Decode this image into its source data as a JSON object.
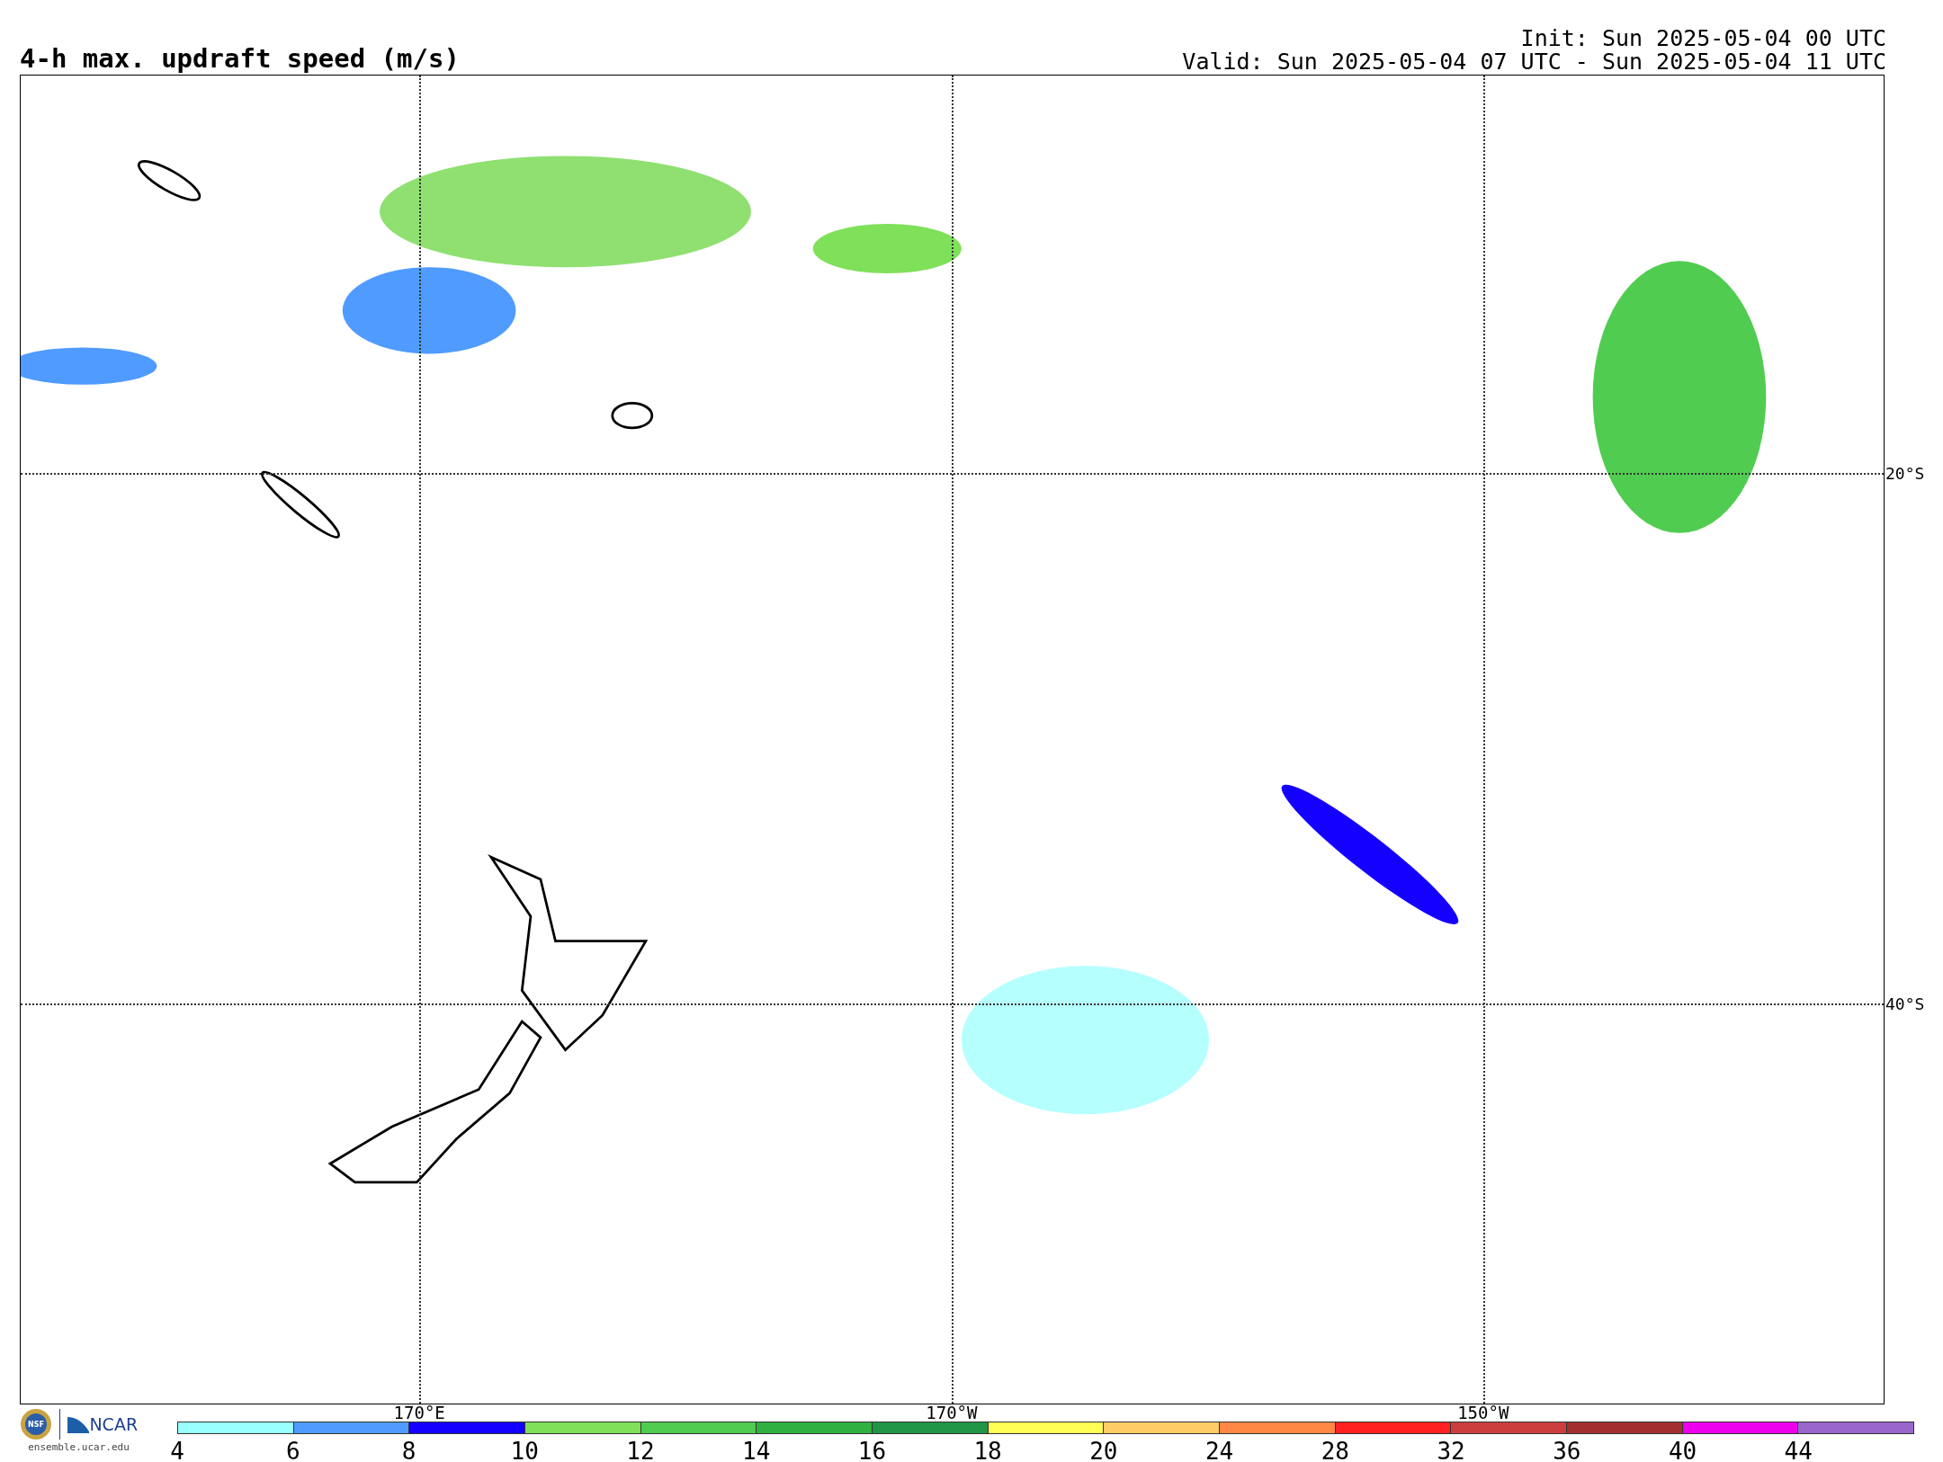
{
  "title": "4-h max. updraft speed (m/s)",
  "init": "Init: Sun 2025-05-04 00 UTC",
  "valid": "Valid: Sun 2025-05-04 07 UTC - Sun 2025-05-04 11 UTC",
  "map": {
    "lat_labels": [
      "20°S",
      "40°S"
    ],
    "lon_labels": [
      "170°E",
      "170°W",
      "150°W"
    ]
  },
  "logo": {
    "seal_text": "NSF",
    "brand": "NCAR",
    "url": "ensemble.ucar.edu"
  },
  "colorbar": {
    "segments": [
      {
        "color": "#99ffff"
      },
      {
        "color": "#4f9bff"
      },
      {
        "color": "#1400ff"
      },
      {
        "color": "#7fe05a"
      },
      {
        "color": "#50cc50"
      },
      {
        "color": "#30b040"
      },
      {
        "color": "#209545"
      },
      {
        "color": "#ffff55"
      },
      {
        "color": "#ffcc66"
      },
      {
        "color": "#ff8844"
      },
      {
        "color": "#ff2020"
      },
      {
        "color": "#cc3d3d"
      },
      {
        "color": "#a33030"
      },
      {
        "color": "#ee00ee"
      },
      {
        "color": "#9966cc"
      }
    ],
    "labels": [
      "4",
      "6",
      "8",
      "10",
      "12",
      "14",
      "16",
      "18",
      "20",
      "24",
      "28",
      "32",
      "36",
      "40",
      "44"
    ]
  }
}
